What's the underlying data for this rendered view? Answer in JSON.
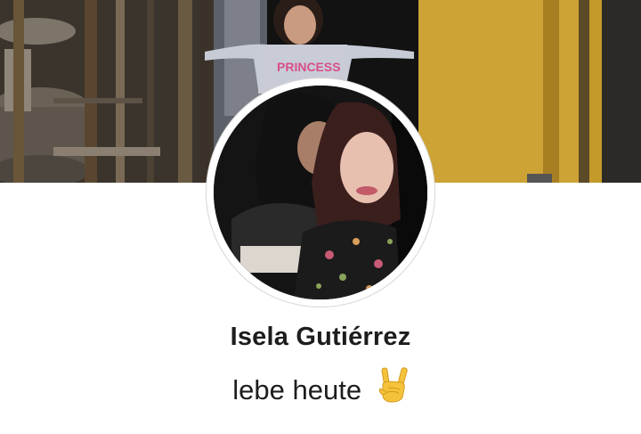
{
  "profile": {
    "name": "Isela Gutiérrez",
    "bio": "lebe heute",
    "bio_emoji_icon": "sign-of-the-horns-icon",
    "cover_shirt_text": "PRINCESS"
  },
  "colors": {
    "cover_wall": "#c49a2b",
    "cover_wood": "#4a3b2a",
    "page_background": "#ffffff",
    "text": "#1d1d1d"
  }
}
